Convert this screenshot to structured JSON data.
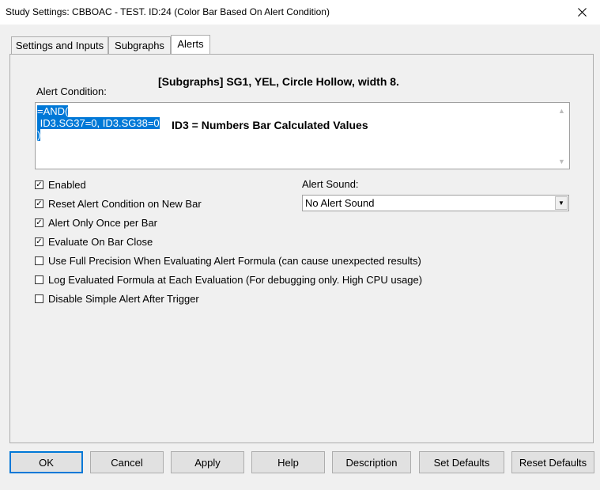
{
  "window": {
    "title": "Study Settings: CBBOAC - TEST. ID:24 (Color Bar Based On Alert Condition)"
  },
  "tabs": [
    {
      "label": "Settings and Inputs"
    },
    {
      "label": "Subgraphs"
    },
    {
      "label": "Alerts"
    }
  ],
  "heading": "[Subgraphs] SG1, YEL, Circle Hollow, width 8.",
  "alert_condition": {
    "label": "Alert Condition:",
    "line1": "=AND(",
    "line2": " ID3.SG37=0, ID3.SG38=0",
    "line3": ")",
    "annotation": "ID3 = Numbers Bar Calculated Values"
  },
  "checkboxes": [
    {
      "label": "Enabled",
      "checked": "✓"
    },
    {
      "label": "Reset Alert Condition on New Bar",
      "checked": "✓"
    },
    {
      "label": "Alert Only Once per Bar",
      "checked": "✓"
    },
    {
      "label": "Evaluate On Bar Close",
      "checked": "✓"
    },
    {
      "label": "Use Full Precision When Evaluating Alert Formula (can cause unexpected results)",
      "checked": ""
    },
    {
      "label": "Log Evaluated Formula at Each Evaluation (For debugging only. High CPU usage)",
      "checked": ""
    },
    {
      "label": "Disable Simple Alert After Trigger",
      "checked": ""
    }
  ],
  "alert_sound": {
    "label": "Alert Sound:",
    "value": "No Alert Sound"
  },
  "buttons": {
    "ok": "OK",
    "cancel": "Cancel",
    "apply": "Apply",
    "help": "Help",
    "description": "Description",
    "set_defaults": "Set Defaults",
    "reset_defaults": "Reset Defaults"
  },
  "colors": {
    "selection": "#0078d7",
    "window_bg": "#f0f0f0"
  }
}
